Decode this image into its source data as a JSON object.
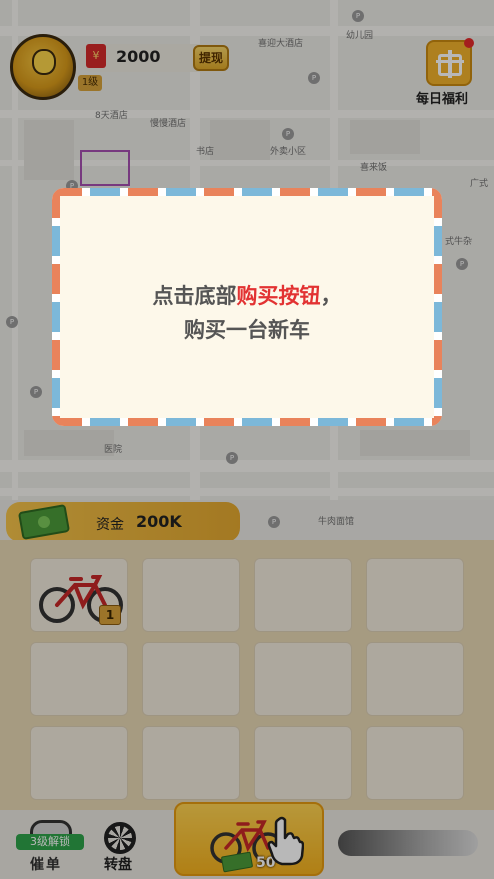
{
  "map": {
    "labels": [
      "喜迎大酒店",
      "幼儿园",
      "8天酒店",
      "慢慢酒店",
      "书店",
      "外卖小区",
      "喜来饭",
      "广式",
      "式牛杂",
      "医院",
      "牛肉面馆"
    ]
  },
  "hud": {
    "cash_icon": "¥",
    "cash": "2000",
    "level": "1级",
    "withdraw_label": "提现",
    "daily_bonus_label": "每日福利"
  },
  "modal": {
    "line1_prefix": "点击底部",
    "line1_highlight": "购买按钮",
    "line1_suffix": "，",
    "line2": "购买一台新车"
  },
  "garage": {
    "funds_label": "资金",
    "funds_value": "200K",
    "slots": [
      {
        "filled": true,
        "level": "1"
      },
      {
        "filled": false
      },
      {
        "filled": false
      },
      {
        "filled": false
      },
      {
        "filled": false
      },
      {
        "filled": false
      },
      {
        "filled": false
      },
      {
        "filled": false
      },
      {
        "filled": false
      },
      {
        "filled": false
      },
      {
        "filled": false
      },
      {
        "filled": false
      }
    ]
  },
  "bottom": {
    "unlock_badge": "3级解锁",
    "order_label": "催单",
    "wheel_label": "转盘",
    "buy_price": "50"
  },
  "colors": {
    "accent": "#f4b11e",
    "highlight_red": "#e23232",
    "unlock_green": "#2fa24a"
  },
  "icons": [
    "red-envelope-icon",
    "gift-icon",
    "money-stack-icon",
    "bicycle-icon",
    "steering-wheel-icon",
    "order-icon",
    "hand-pointer-icon"
  ]
}
